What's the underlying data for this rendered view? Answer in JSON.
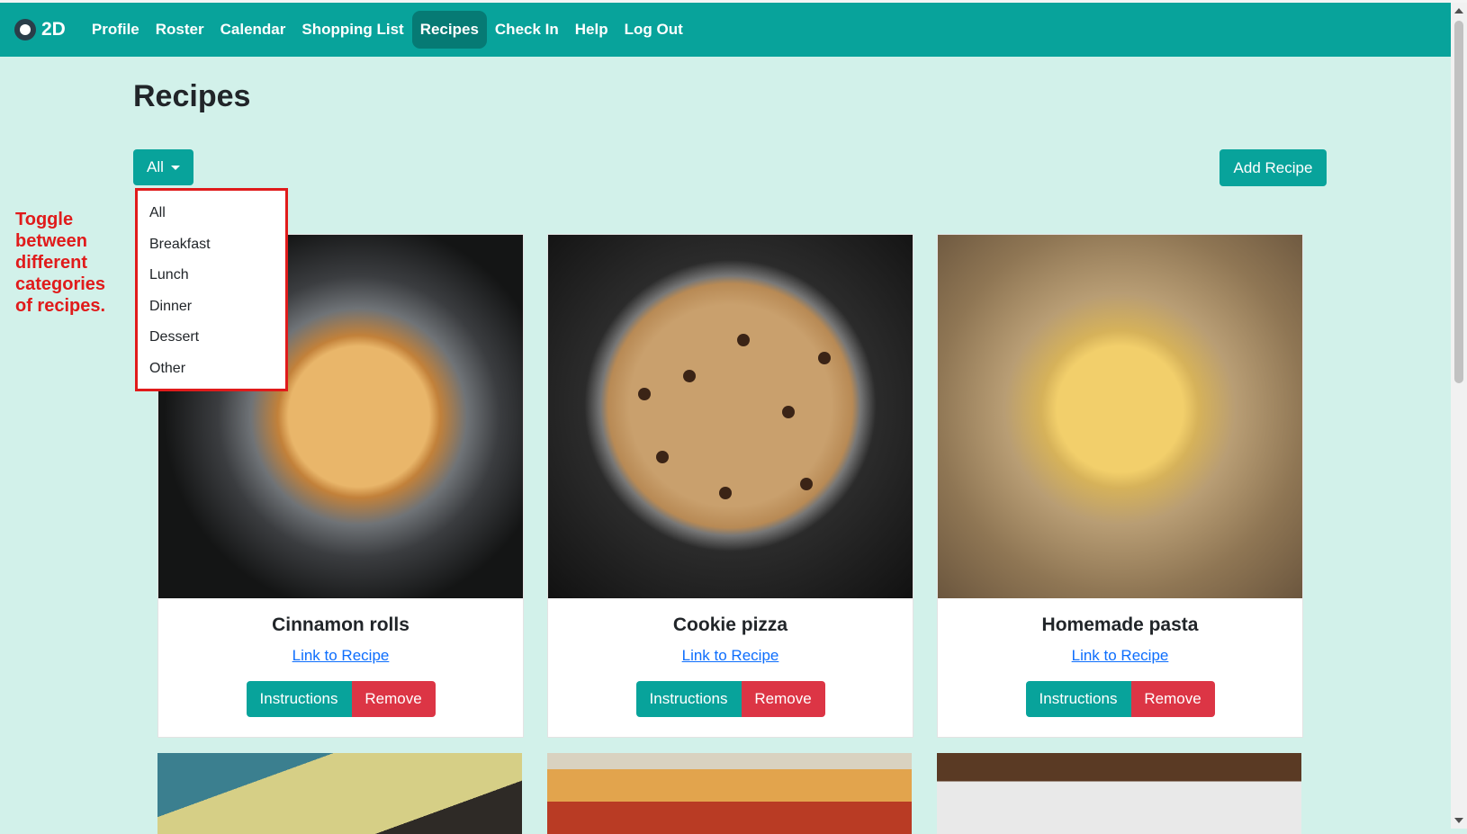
{
  "brand": {
    "name": "2D",
    "logo_icon": "plate-icon"
  },
  "nav": {
    "items": [
      "Profile",
      "Roster",
      "Calendar",
      "Shopping List",
      "Recipes",
      "Check In",
      "Help",
      "Log Out"
    ],
    "active": "Recipes"
  },
  "page": {
    "title": "Recipes"
  },
  "filter": {
    "selected": "All",
    "options": [
      "All",
      "Breakfast",
      "Lunch",
      "Dinner",
      "Dessert",
      "Other"
    ]
  },
  "add_recipe_label": "Add Recipe",
  "annotation": "Toggle between different categories of recipes.",
  "recipes": [
    {
      "title": "Cinnamon rolls",
      "link_label": "Link to Recipe",
      "instructions_label": "Instructions",
      "remove_label": "Remove"
    },
    {
      "title": "Cookie pizza",
      "link_label": "Link to Recipe",
      "instructions_label": "Instructions",
      "remove_label": "Remove"
    },
    {
      "title": "Homemade pasta",
      "link_label": "Link to Recipe",
      "instructions_label": "Instructions",
      "remove_label": "Remove"
    }
  ],
  "colors": {
    "accent": "#08a39b",
    "danger": "#dc3545",
    "background": "#d2f1ea",
    "annotation": "#e01b1b"
  }
}
